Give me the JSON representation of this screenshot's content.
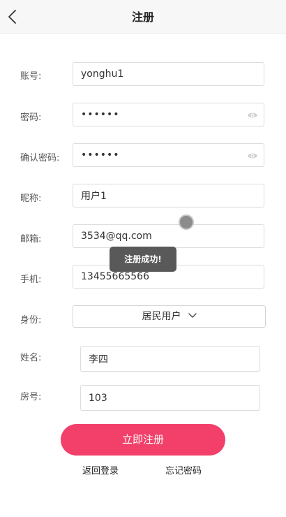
{
  "header": {
    "title": "注册"
  },
  "form": {
    "account": {
      "label": "账号:",
      "value": "yonghu1"
    },
    "password": {
      "label": "密码:",
      "value": "••••••"
    },
    "confirm_password": {
      "label": "确认密码:",
      "value": "••••••"
    },
    "nickname": {
      "label": "昵称:",
      "value": "用户1"
    },
    "email": {
      "label": "邮箱:",
      "value": "3534@qq.com"
    },
    "phone": {
      "label": "手机:",
      "value": "13455665566"
    },
    "identity": {
      "label": "身份:",
      "selected": "居民用户"
    },
    "name": {
      "label": "姓名:",
      "value": "李四"
    },
    "room": {
      "label": "房号:",
      "value": "103"
    }
  },
  "actions": {
    "submit_label": "立即注册",
    "back_login_label": "返回登录",
    "forgot_password_label": "忘记密码"
  },
  "toast": {
    "message": "注册成功!"
  },
  "colors": {
    "accent": "#f2406a",
    "toast_bg": "#595959",
    "header_bg": "#f7f7f7"
  },
  "icons": {
    "back": "chevron-left-icon",
    "eye": "eye-icon",
    "dropdown": "chevron-down-icon"
  }
}
